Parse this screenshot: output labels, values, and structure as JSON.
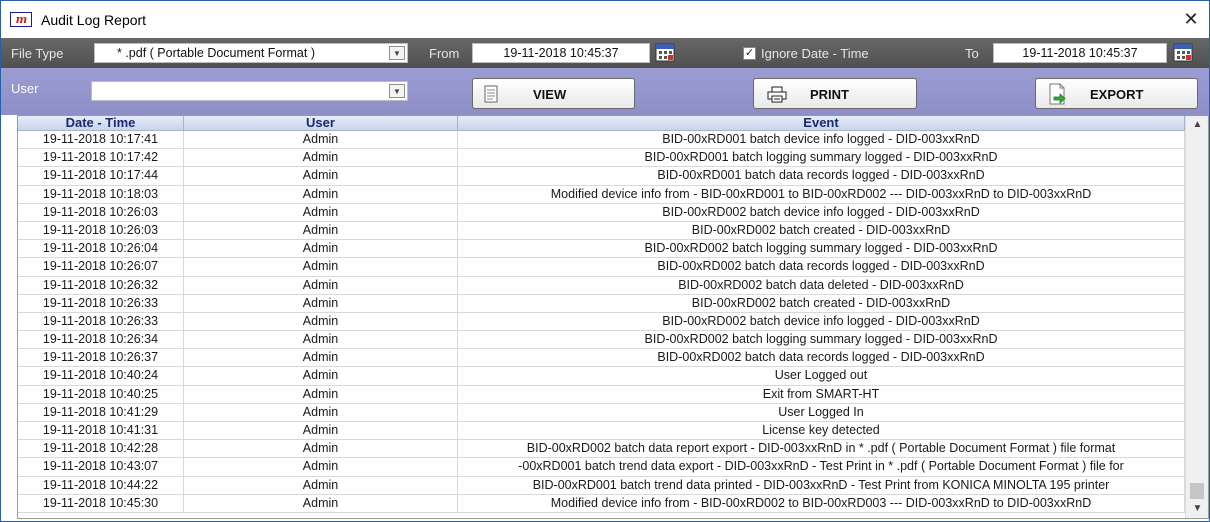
{
  "window": {
    "title": "Audit Log Report",
    "app_icon_text": "m",
    "close_glyph": "✕"
  },
  "filter_bar": {
    "file_type_label": "File Type",
    "file_type_value": "* .pdf ( Portable Document Format )",
    "from_label": "From",
    "from_value": "19-11-2018 10:45:37",
    "ignore_checked": true,
    "ignore_label": "Ignore Date - Time",
    "to_label": "To",
    "to_value": "19-11-2018 10:45:37"
  },
  "user_bar": {
    "user_label": "User",
    "user_value": "",
    "view_label": "VIEW",
    "print_label": "PRINT",
    "export_label": "EXPORT"
  },
  "table": {
    "columns": [
      "Date - Time",
      "User",
      "Event"
    ],
    "rows": [
      [
        "19-11-2018  10:17:41",
        "Admin",
        "BID-00xRD001 batch device info logged - DID-003xxRnD"
      ],
      [
        "19-11-2018  10:17:42",
        "Admin",
        "BID-00xRD001 batch logging summary logged - DID-003xxRnD"
      ],
      [
        "19-11-2018  10:17:44",
        "Admin",
        "BID-00xRD001 batch data records logged - DID-003xxRnD"
      ],
      [
        "19-11-2018  10:18:03",
        "Admin",
        "Modified device info from - BID-00xRD001 to BID-00xRD002 --- DID-003xxRnD to DID-003xxRnD"
      ],
      [
        "19-11-2018  10:26:03",
        "Admin",
        "BID-00xRD002 batch device info logged - DID-003xxRnD"
      ],
      [
        "19-11-2018  10:26:03",
        "Admin",
        "BID-00xRD002 batch created - DID-003xxRnD"
      ],
      [
        "19-11-2018  10:26:04",
        "Admin",
        "BID-00xRD002 batch logging summary logged - DID-003xxRnD"
      ],
      [
        "19-11-2018  10:26:07",
        "Admin",
        "BID-00xRD002 batch data records logged - DID-003xxRnD"
      ],
      [
        "19-11-2018  10:26:32",
        "Admin",
        "BID-00xRD002 batch data deleted - DID-003xxRnD"
      ],
      [
        "19-11-2018  10:26:33",
        "Admin",
        "BID-00xRD002 batch created - DID-003xxRnD"
      ],
      [
        "19-11-2018  10:26:33",
        "Admin",
        "BID-00xRD002 batch device info logged - DID-003xxRnD"
      ],
      [
        "19-11-2018  10:26:34",
        "Admin",
        "BID-00xRD002 batch logging summary logged - DID-003xxRnD"
      ],
      [
        "19-11-2018  10:26:37",
        "Admin",
        "BID-00xRD002 batch data records logged - DID-003xxRnD"
      ],
      [
        "19-11-2018  10:40:24",
        "Admin",
        "User Logged out"
      ],
      [
        "19-11-2018  10:40:25",
        "Admin",
        "Exit from SMART-HT"
      ],
      [
        "19-11-2018  10:41:29",
        "Admin",
        "User Logged In"
      ],
      [
        "19-11-2018  10:41:31",
        "Admin",
        "License key detected"
      ],
      [
        "19-11-2018  10:42:28",
        "Admin",
        "BID-00xRD002 batch data report export - DID-003xxRnD in * .pdf ( Portable Document Format ) file format"
      ],
      [
        "19-11-2018  10:43:07",
        "Admin",
        "-00xRD001 batch trend data export - DID-003xxRnD - Test Print in * .pdf ( Portable Document Format ) file for"
      ],
      [
        "19-11-2018  10:44:22",
        "Admin",
        "BID-00xRD001 batch trend data printed - DID-003xxRnD - Test Print from KONICA MINOLTA 195 printer"
      ],
      [
        "19-11-2018  10:45:30",
        "Admin",
        "Modified device info from - BID-00xRD002 to BID-00xRD003 --- DID-003xxRnD to DID-003xxRnD"
      ]
    ]
  },
  "colors": {
    "filter_bar_bg": "#5a5a5a",
    "user_bar_bg": "#9596cc",
    "header_text": "#1a2a6e"
  }
}
